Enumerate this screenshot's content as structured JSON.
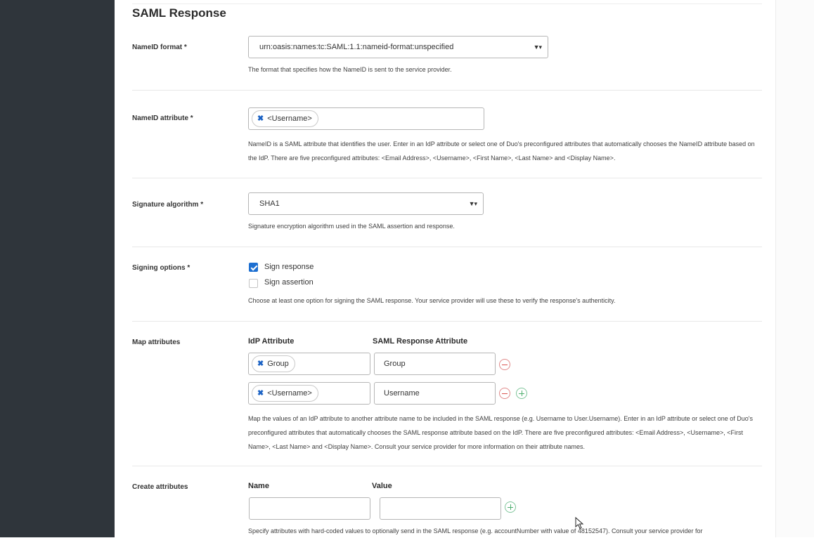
{
  "section": {
    "title": "SAML Response"
  },
  "nameid_format": {
    "label": "NameID format *",
    "value": "urn:oasis:names:tc:SAML:1.1:nameid-format:unspecified",
    "help": "The format that specifies how the NameID is sent to the service provider."
  },
  "nameid_attribute": {
    "label": "NameID attribute *",
    "tag": "<Username>",
    "help": "NameID is a SAML attribute that identifies the user. Enter in an IdP attribute or select one of Duo's preconfigured attributes that automatically chooses the NameID attribute based on the IdP. There are five preconfigured attributes: <Email Address>, <Username>, <First Name>, <Last Name> and <Display Name>."
  },
  "signature_algorithm": {
    "label": "Signature algorithm *",
    "value": "SHA1",
    "help": "Signature encryption algorithm used in the SAML assertion and response."
  },
  "signing_options": {
    "label": "Signing options *",
    "options": [
      {
        "label": "Sign response",
        "checked": true
      },
      {
        "label": "Sign assertion",
        "checked": false
      }
    ],
    "help": "Choose at least one option for signing the SAML response. Your service provider will use these to verify the response's authenticity."
  },
  "map_attributes": {
    "label": "Map attributes",
    "col_idp": "IdP Attribute",
    "col_saml": "SAML Response Attribute",
    "rows": [
      {
        "idp": "Group",
        "saml": "Group"
      },
      {
        "idp": "<Username>",
        "saml": "Username"
      }
    ],
    "help": "Map the values of an IdP attribute to another attribute name to be included in the SAML response (e.g. Username to User.Username). Enter in an IdP attribute or select one of Duo's preconfigured attributes that automatically chooses the SAML response attribute based on the IdP. There are five preconfigured attributes: <Email Address>, <Username>, <First Name>, <Last Name> and <Display Name>. Consult your service provider for more information on their attribute names."
  },
  "create_attributes": {
    "label": "Create attributes",
    "col_name": "Name",
    "col_value": "Value",
    "name_value": "",
    "value_value": "",
    "help": "Specify attributes with hard-coded values to optionally send in the SAML response (e.g. accountNumber with value of 48152547). Consult your service provider for"
  },
  "icons": {
    "remove_tag": "close-icon",
    "dropdown": "chevron-down-icon",
    "remove_row": "minus-circle-icon",
    "add_row": "plus-circle-icon"
  },
  "colors": {
    "sidebar": "#2f353b",
    "checkbox": "#1d6fd1",
    "minus": "#d9534f",
    "plus": "#4cae6e"
  }
}
